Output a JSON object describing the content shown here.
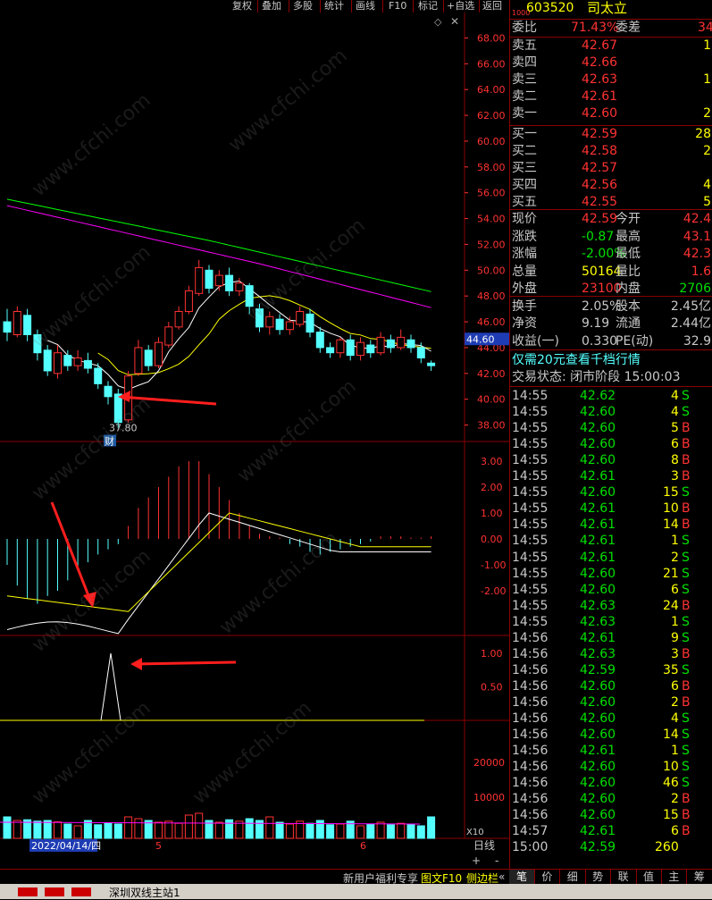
{
  "toolbar": {
    "buttons": [
      "复权",
      "叠加",
      "多股",
      "统计",
      "画线",
      "F10",
      "标记",
      "+自选",
      "返回"
    ]
  },
  "chart": {
    "price_axis": [
      "68.00",
      "66.00",
      "64.00",
      "62.00",
      "60.00",
      "58.00",
      "56.00",
      "54.00",
      "52.00",
      "50.00",
      "48.00",
      "46.00",
      "44.00",
      "42.00",
      "40.00",
      "38.00"
    ],
    "current_price_tag": "44.60",
    "low_label": "37.80",
    "event_tag": "财",
    "macd_axis": [
      "3.00",
      "2.00",
      "1.00",
      "0.00",
      "-1.00",
      "-2.00"
    ],
    "signal_axis": [
      "1.00",
      "0.50"
    ],
    "volume_axis": [
      "20000",
      "10000"
    ],
    "volume_unit": "X10",
    "date_label": "2022/04/14/四",
    "month_labels": [
      "5",
      "6"
    ],
    "period_label": "日线",
    "zoom_plus": "+",
    "zoom_minus": "-",
    "bottom_links": "新用户福利专享",
    "bottom_tabs": [
      "图文F10",
      "侧边栏",
      "«"
    ],
    "status_text": "深圳双线主站1"
  },
  "chart_data": {
    "type": "candlestick",
    "ylim": [
      37,
      69
    ],
    "candles": [
      [
        46.0,
        45.2,
        47.0,
        44.5
      ],
      [
        45.0,
        46.8,
        47.2,
        44.8
      ],
      [
        46.5,
        45.0,
        47.0,
        44.5
      ],
      [
        45.0,
        43.6,
        45.4,
        43.0
      ],
      [
        43.8,
        42.2,
        44.2,
        41.8
      ],
      [
        42.0,
        43.6,
        44.2,
        41.6
      ],
      [
        43.4,
        42.6,
        43.8,
        42.2
      ],
      [
        42.6,
        43.2,
        43.8,
        42.2
      ],
      [
        43.0,
        42.4,
        43.6,
        42.0
      ],
      [
        42.4,
        41.2,
        42.8,
        40.8
      ],
      [
        41.0,
        40.2,
        41.4,
        39.6
      ],
      [
        40.4,
        38.2,
        40.8,
        37.8
      ],
      [
        38.4,
        41.8,
        42.2,
        38.2
      ],
      [
        42.0,
        44.0,
        44.6,
        41.8
      ],
      [
        43.8,
        42.6,
        44.2,
        42.2
      ],
      [
        42.6,
        44.4,
        44.8,
        42.4
      ],
      [
        44.2,
        45.6,
        46.0,
        44.0
      ],
      [
        45.6,
        46.8,
        47.2,
        45.4
      ],
      [
        46.8,
        48.4,
        48.8,
        46.6
      ],
      [
        48.2,
        50.2,
        50.8,
        48.0
      ],
      [
        50.0,
        48.6,
        50.4,
        48.2
      ],
      [
        48.8,
        49.6,
        50.0,
        48.4
      ],
      [
        49.6,
        48.4,
        50.2,
        48.0
      ],
      [
        48.4,
        49.0,
        49.4,
        48.0
      ],
      [
        48.8,
        47.2,
        49.0,
        46.6
      ],
      [
        47.0,
        45.6,
        47.4,
        45.2
      ],
      [
        45.6,
        46.4,
        46.8,
        45.0
      ],
      [
        46.2,
        45.4,
        46.6,
        45.0
      ],
      [
        45.4,
        46.0,
        46.4,
        45.0
      ],
      [
        45.8,
        46.8,
        47.2,
        45.6
      ],
      [
        46.6,
        45.2,
        47.0,
        44.8
      ],
      [
        45.2,
        44.0,
        45.6,
        43.6
      ],
      [
        44.0,
        43.6,
        44.4,
        43.2
      ],
      [
        43.6,
        44.6,
        44.8,
        43.2
      ],
      [
        44.6,
        43.4,
        45.0,
        43.0
      ],
      [
        43.4,
        44.4,
        44.8,
        43.0
      ],
      [
        44.2,
        43.6,
        44.6,
        43.2
      ],
      [
        43.6,
        44.8,
        45.2,
        43.4
      ],
      [
        44.6,
        44.0,
        45.0,
        43.6
      ],
      [
        44.0,
        44.8,
        45.4,
        43.8
      ],
      [
        44.6,
        44.0,
        45.0,
        43.6
      ],
      [
        44.0,
        43.2,
        44.4,
        42.8
      ],
      [
        42.8,
        42.6,
        43.0,
        42.2
      ]
    ],
    "macd_hist": [
      -1.0,
      -1.8,
      -2.3,
      -2.5,
      -2.2,
      -2.0,
      -1.6,
      -1.2,
      -0.9,
      -0.6,
      -0.4,
      -0.2,
      0.5,
      1.2,
      1.6,
      2.0,
      2.4,
      2.8,
      3.0,
      3.0,
      2.5,
      2.0,
      1.5,
      1.0,
      0.5,
      0.2,
      0.1,
      0.05,
      -0.2,
      -0.3,
      -0.5,
      -0.6,
      -0.5,
      -0.4,
      -0.3,
      -0.2,
      -0.1,
      0.1,
      0.1,
      0.1,
      0.05,
      0.05,
      0.1
    ],
    "volume": [
      600,
      500,
      520,
      480,
      500,
      460,
      400,
      350,
      500,
      380,
      420,
      400,
      600,
      550,
      500,
      450,
      480,
      420,
      650,
      700,
      500,
      450,
      520,
      480,
      550,
      500,
      600,
      450,
      400,
      480,
      420,
      500,
      380,
      400,
      480,
      350,
      400,
      450,
      380,
      420,
      400,
      350,
      600
    ]
  },
  "sidebar": {
    "code": "603520",
    "name": "司太立",
    "badge": "1000",
    "weibi_label": "委比",
    "weibi_value": "71.43%",
    "weicha_label": "委差",
    "weicha_value": "34",
    "sell_rows": [
      {
        "label": "卖五",
        "price": "42.67",
        "vol": "1"
      },
      {
        "label": "卖四",
        "price": "42.66",
        "vol": ""
      },
      {
        "label": "卖三",
        "price": "42.63",
        "vol": "1"
      },
      {
        "label": "卖二",
        "price": "42.61",
        "vol": ""
      },
      {
        "label": "卖一",
        "price": "42.60",
        "vol": "2"
      }
    ],
    "buy_rows": [
      {
        "label": "买一",
        "price": "42.59",
        "vol": "28"
      },
      {
        "label": "买二",
        "price": "42.58",
        "vol": "2"
      },
      {
        "label": "买三",
        "price": "42.57",
        "vol": ""
      },
      {
        "label": "买四",
        "price": "42.56",
        "vol": "4"
      },
      {
        "label": "买五",
        "price": "42.55",
        "vol": "5"
      }
    ],
    "stats": [
      {
        "l1": "现价",
        "v1": "42.59",
        "l2": "今开",
        "v2": "42.4"
      },
      {
        "l1": "涨跌",
        "v1": "-0.87",
        "l2": "最高",
        "v2": "43.1"
      },
      {
        "l1": "涨幅",
        "v1": "-2.00%",
        "l2": "最低",
        "v2": "42.3"
      },
      {
        "l1": "总量",
        "v1": "50164",
        "l2": "量比",
        "v2": "1.6"
      },
      {
        "l1": "外盘",
        "v1": "23100",
        "l2": "内盘",
        "v2": "2706"
      },
      {
        "l1": "换手",
        "v1": "2.05%",
        "l2": "股本",
        "v2": "2.45亿"
      },
      {
        "l1": "净资",
        "v1": "9.19",
        "l2": "流通",
        "v2": "2.44亿"
      },
      {
        "l1": "收益(一)",
        "v1": "0.330",
        "l2": "PE(动)",
        "v2": "32.9"
      }
    ],
    "promo": "仅需20元查看千档行情",
    "trade_status": "交易状态: 闭市阶段 15:00:03",
    "ticks": [
      {
        "t": "14:55",
        "p": "42.62",
        "v": "4",
        "d": "S"
      },
      {
        "t": "14:55",
        "p": "42.60",
        "v": "4",
        "d": "S"
      },
      {
        "t": "14:55",
        "p": "42.60",
        "v": "5",
        "d": "B"
      },
      {
        "t": "14:55",
        "p": "42.60",
        "v": "6",
        "d": "B"
      },
      {
        "t": "14:55",
        "p": "42.60",
        "v": "8",
        "d": "B"
      },
      {
        "t": "14:55",
        "p": "42.61",
        "v": "3",
        "d": "B"
      },
      {
        "t": "14:55",
        "p": "42.60",
        "v": "15",
        "d": "S"
      },
      {
        "t": "14:55",
        "p": "42.61",
        "v": "10",
        "d": "B"
      },
      {
        "t": "14:55",
        "p": "42.61",
        "v": "14",
        "d": "B"
      },
      {
        "t": "14:55",
        "p": "42.61",
        "v": "1",
        "d": "S"
      },
      {
        "t": "14:55",
        "p": "42.61",
        "v": "2",
        "d": "S"
      },
      {
        "t": "14:55",
        "p": "42.60",
        "v": "21",
        "d": "S"
      },
      {
        "t": "14:55",
        "p": "42.60",
        "v": "6",
        "d": "S"
      },
      {
        "t": "14:55",
        "p": "42.63",
        "v": "24",
        "d": "B"
      },
      {
        "t": "14:55",
        "p": "42.63",
        "v": "1",
        "d": "S"
      },
      {
        "t": "14:56",
        "p": "42.61",
        "v": "9",
        "d": "S"
      },
      {
        "t": "14:56",
        "p": "42.63",
        "v": "3",
        "d": "B"
      },
      {
        "t": "14:56",
        "p": "42.59",
        "v": "35",
        "d": "S"
      },
      {
        "t": "14:56",
        "p": "42.60",
        "v": "6",
        "d": "B"
      },
      {
        "t": "14:56",
        "p": "42.60",
        "v": "2",
        "d": "B"
      },
      {
        "t": "14:56",
        "p": "42.60",
        "v": "4",
        "d": "S"
      },
      {
        "t": "14:56",
        "p": "42.60",
        "v": "14",
        "d": "S"
      },
      {
        "t": "14:56",
        "p": "42.61",
        "v": "1",
        "d": "S"
      },
      {
        "t": "14:56",
        "p": "42.60",
        "v": "10",
        "d": "S"
      },
      {
        "t": "14:56",
        "p": "42.60",
        "v": "46",
        "d": "S"
      },
      {
        "t": "14:56",
        "p": "42.60",
        "v": "2",
        "d": "B"
      },
      {
        "t": "14:56",
        "p": "42.60",
        "v": "15",
        "d": "B"
      },
      {
        "t": "14:57",
        "p": "42.61",
        "v": "6",
        "d": "B"
      },
      {
        "t": "15:00",
        "p": "42.59",
        "v": "260",
        "d": ""
      }
    ],
    "tabs": [
      "笔",
      "价",
      "细",
      "势",
      "联",
      "值",
      "主",
      "筹"
    ]
  },
  "colors": {
    "up": "#ff3232",
    "down": "#54ffff",
    "ma1": "#ffffff",
    "ma2": "#ffff00",
    "ma3": "#00ff00",
    "ma4": "#ff00ff",
    "axis": "#ff3232",
    "grid": "#8b0000"
  }
}
